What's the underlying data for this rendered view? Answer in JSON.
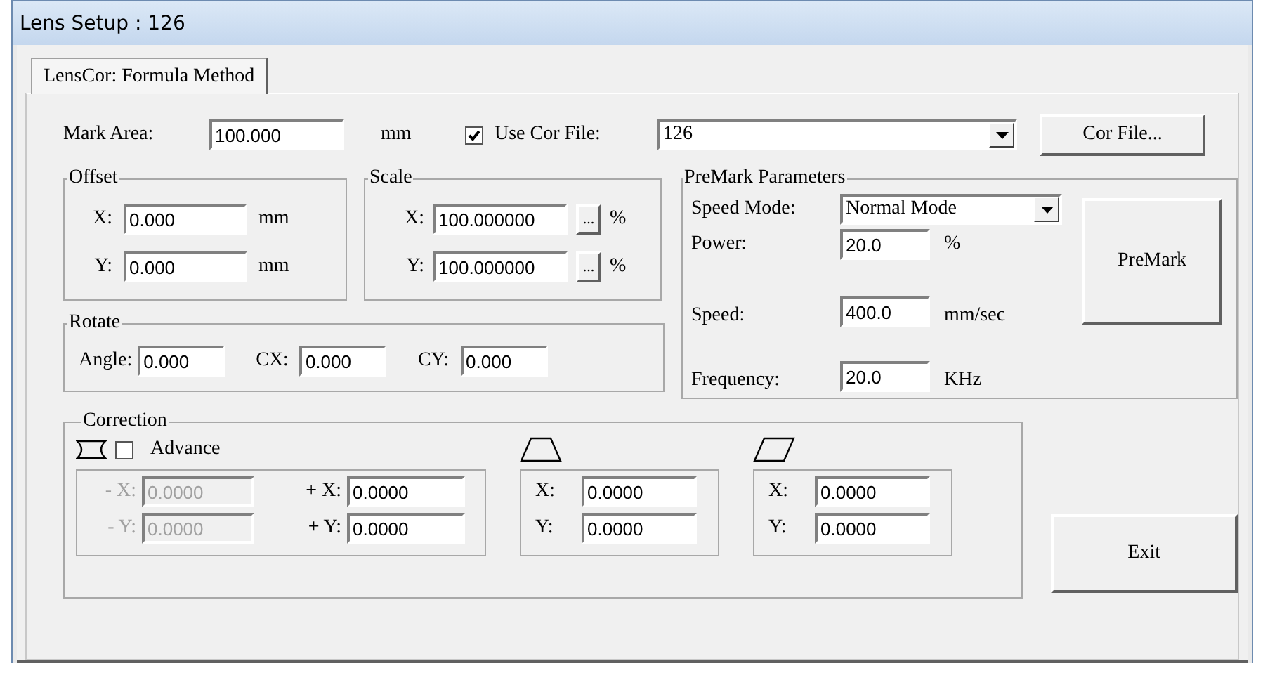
{
  "window": {
    "title": "Lens Setup : 126"
  },
  "tabs": [
    {
      "label": "LensCor: Formula Method",
      "selected": true
    }
  ],
  "mark_area": {
    "label": "Mark Area:",
    "value": "100.000",
    "unit": "mm"
  },
  "use_cor_file": {
    "label": "Use Cor File:",
    "checked": true
  },
  "cor_file_combo": {
    "value": "126"
  },
  "cor_file_button": "Cor File...",
  "offset": {
    "title": "Offset",
    "fields": [
      {
        "label": "X:",
        "value": "0.000",
        "unit": "mm"
      },
      {
        "label": "Y:",
        "value": "0.000",
        "unit": "mm"
      }
    ]
  },
  "scale": {
    "title": "Scale",
    "fields": [
      {
        "label": "X:",
        "value": "100.000000",
        "button": "...",
        "unit": "%"
      },
      {
        "label": "Y:",
        "value": "100.000000",
        "button": "...",
        "unit": "%"
      }
    ]
  },
  "rotate": {
    "title": "Rotate",
    "fields": [
      {
        "label": "Angle:",
        "value": "0.000"
      },
      {
        "label": "CX:",
        "value": "0.000"
      },
      {
        "label": "CY:",
        "value": "0.000"
      }
    ]
  },
  "premark": {
    "title": "PreMark Parameters",
    "speed_mode": {
      "label": "Speed Mode:",
      "value": "Normal Mode"
    },
    "fields": [
      {
        "label": "Power:",
        "value": "20.0",
        "unit": "%"
      },
      {
        "label": "Speed:",
        "value": "400.0",
        "unit": "mm/sec"
      },
      {
        "label": "Frequency:",
        "value": "20.0",
        "unit": "KHz"
      }
    ],
    "button": "PreMark"
  },
  "correction": {
    "title": "Correction",
    "advance": {
      "label": "Advance",
      "checked": false
    },
    "barrel": {
      "fields": [
        {
          "label": "- X:",
          "value": "0.0000",
          "disabled": true
        },
        {
          "label": "+ X:",
          "value": "0.0000",
          "disabled": false
        },
        {
          "label": "- Y:",
          "value": "0.0000",
          "disabled": true
        },
        {
          "label": "+ Y:",
          "value": "0.0000",
          "disabled": false
        }
      ]
    },
    "trapezoid": {
      "fields": [
        {
          "label": "X:",
          "value": "0.0000"
        },
        {
          "label": "Y:",
          "value": "0.0000"
        }
      ]
    },
    "parallelogram": {
      "fields": [
        {
          "label": "X:",
          "value": "0.0000"
        },
        {
          "label": "Y:",
          "value": "0.0000"
        }
      ]
    }
  },
  "exit_button": "Exit"
}
